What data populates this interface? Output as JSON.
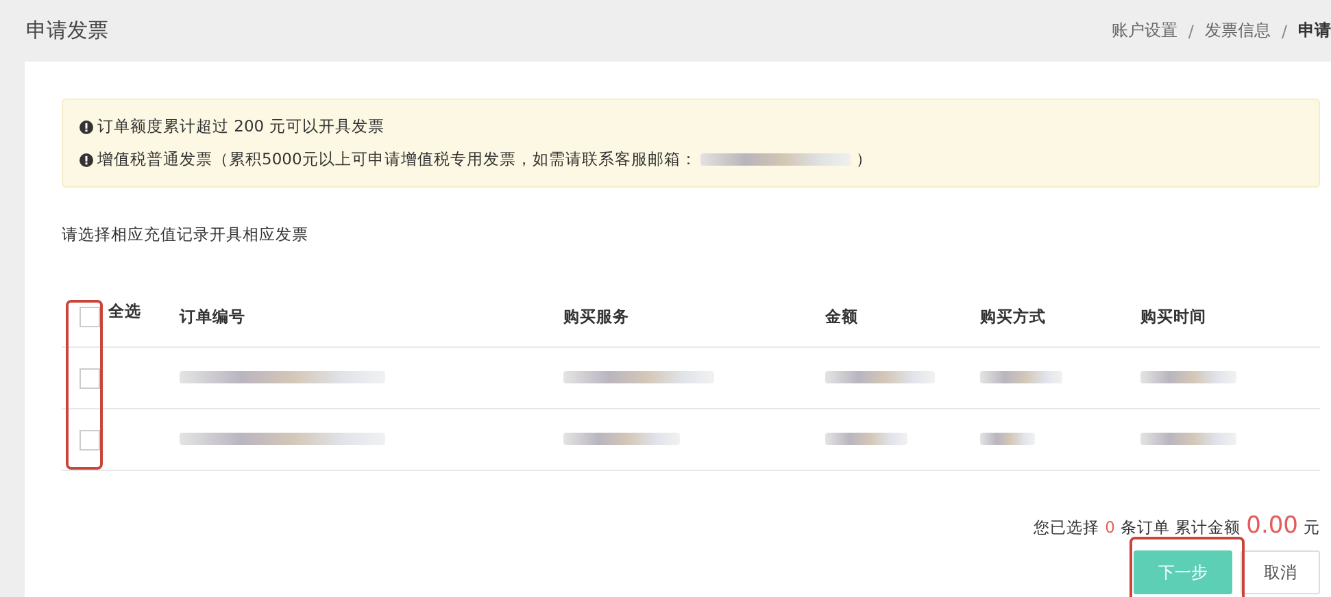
{
  "page": {
    "title": "申请发票"
  },
  "breadcrumb_separator": "/",
  "breadcrumb": [
    {
      "label": "账户设置",
      "current": false
    },
    {
      "label": "发票信息",
      "current": false
    },
    {
      "label": "申请",
      "current": true
    }
  ],
  "notices": [
    {
      "text": "订单额度累计超过 200 元可以开具发票",
      "redacted_email": false
    },
    {
      "text": "增值税普通发票（累积5000元以上可申请增值税专用发票，如需请联系客服邮箱：",
      "redacted_email": true,
      "suffix": "）"
    }
  ],
  "instruction": "请选择相应充值记录开具相应发票",
  "table": {
    "select_all": {
      "label": "全选",
      "checked": false
    },
    "columns": [
      "订单编号",
      "购买服务",
      "金额",
      "购买方式",
      "购买时间"
    ],
    "rows": [
      {
        "checked": false
      },
      {
        "checked": false
      }
    ]
  },
  "summary": {
    "prefix": "您已选择",
    "count": "0",
    "middle": "条订单 累计金额",
    "amount": "0.00",
    "unit": "元"
  },
  "buttons": [
    {
      "label": "下一步",
      "kind": "primary"
    },
    {
      "label": "取消",
      "kind": "default"
    }
  ]
}
